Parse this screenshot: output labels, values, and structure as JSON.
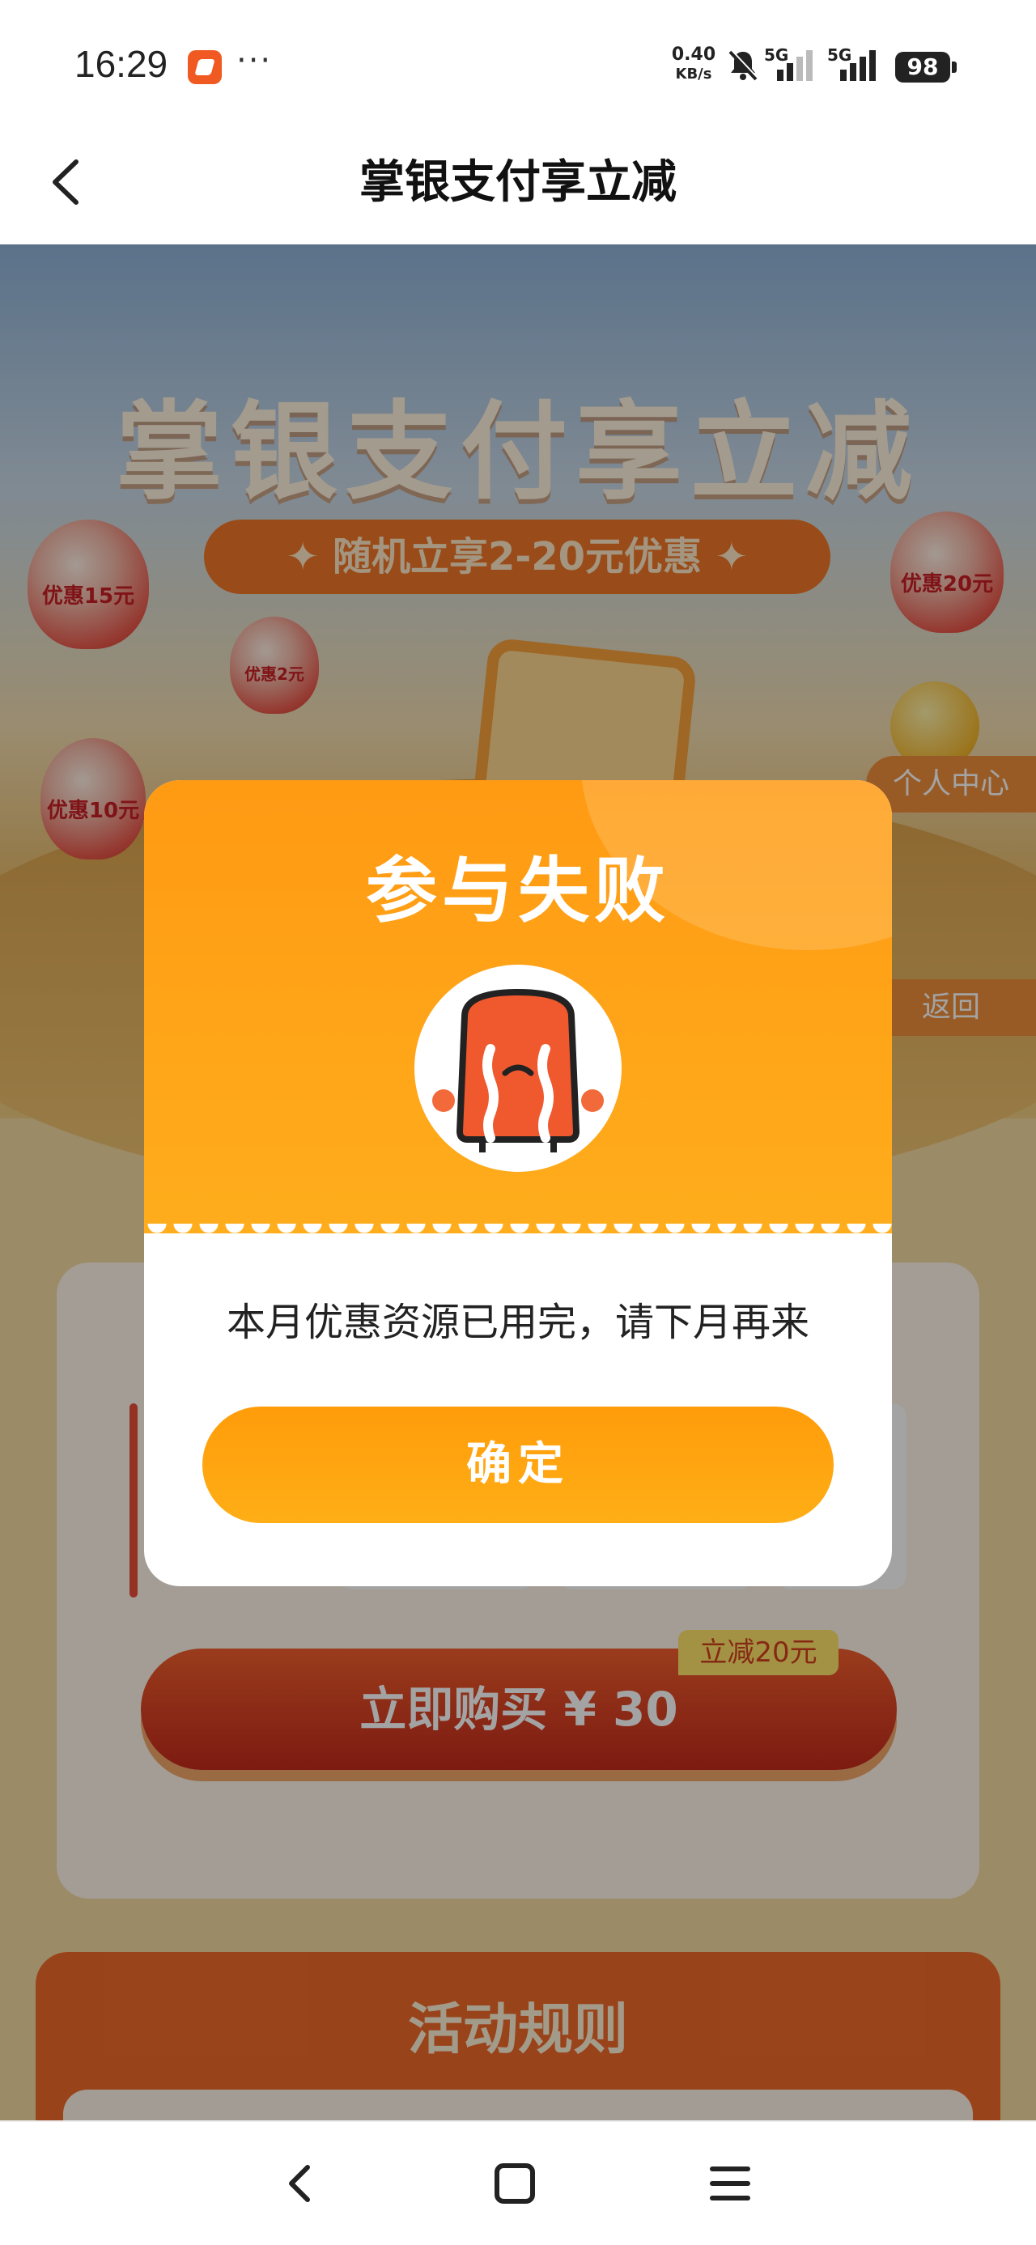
{
  "status_bar": {
    "time": "16:29",
    "app_icon": "message-app-icon",
    "more_dots": "···",
    "net_speed_value": "0.40",
    "net_speed_unit": "KB/s",
    "network_1": "5G",
    "network_2": "5G",
    "battery": "98"
  },
  "nav": {
    "title": "掌银支付享立减",
    "back_icon": "chevron-left-icon"
  },
  "hero": {
    "title": "掌银支付享立减",
    "subtitle": "随机立享2-20元优惠",
    "lanterns": [
      "优惠15元",
      "优惠2元",
      "优惠10元",
      "优惠20元"
    ],
    "side_button_1": "个人中心",
    "side_button_2": "返回"
  },
  "purchase": {
    "buy_button": "立即购买 ¥ 30",
    "discount_tag": "立减20元"
  },
  "rules": {
    "title": "活动规则"
  },
  "dialog": {
    "title": "参与失败",
    "message": "本月优惠资源已用完，请下月再来",
    "confirm_button": "确定",
    "icon": "crying-mascot-icon"
  },
  "system_nav": {
    "back": "back-triangle-icon",
    "home": "home-square-icon",
    "menu": "menu-lines-icon"
  },
  "colors": {
    "accent_orange": "#ff9f10",
    "brand_red": "#e9452e",
    "overlay": "rgba(0,0,0,0.36)"
  }
}
